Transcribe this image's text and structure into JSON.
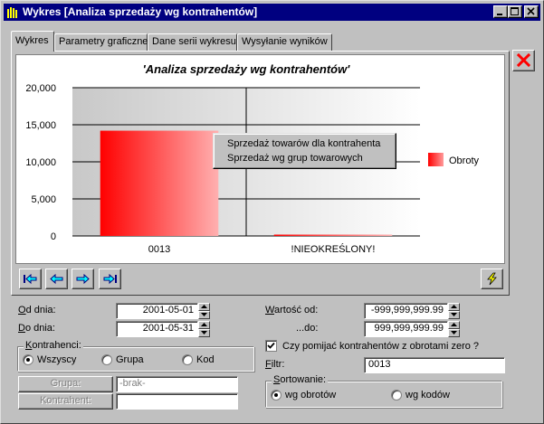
{
  "window": {
    "title": "Wykres [Analiza sprzedaży wg kontrahentów]",
    "app_icon": "bar-chart-icon",
    "controls": [
      "minimize-icon",
      "maximize-icon",
      "close-icon"
    ]
  },
  "tabs": [
    {
      "label": "Wykres",
      "active": true
    },
    {
      "label": "Parametry graficzne",
      "active": false
    },
    {
      "label": "Dane serii wykresu",
      "active": false
    },
    {
      "label": "Wysyłanie wyników",
      "active": false
    }
  ],
  "close_button_icon": "red-x-icon",
  "chart_data": {
    "type": "bar",
    "title": "'Analiza sprzedaży wg kontrahentów'",
    "categories": [
      "0013",
      "!NIEOKREŚLONY!"
    ],
    "series": [
      {
        "name": "Obroty",
        "values": [
          14200,
          150
        ],
        "color": "#ff0000"
      }
    ],
    "ylim": [
      0,
      20000
    ],
    "yticks": [
      "0",
      "5,000",
      "10,000",
      "15,000",
      "20,000"
    ],
    "grid": true,
    "legend": "right"
  },
  "context_menu": {
    "items": [
      "Sprzedaż towarów dla kontrahenta",
      "Sprzedaż wg grup towarowych"
    ]
  },
  "nav_buttons": [
    "first-icon",
    "prev-icon",
    "next-icon",
    "last-icon"
  ],
  "refresh_button_icon": "lightning-icon",
  "form": {
    "od_dnia_label": "Od dnia:",
    "od_dnia_value": "2001-05-01",
    "do_dnia_label": "Do dnia:",
    "do_dnia_value": "2001-05-31",
    "wartosc_od_label": "Wartość od:",
    "wartosc_od_value": "-999,999,999.99",
    "do_label": "...do:",
    "do_value": "999,999,999.99",
    "kontrahenci_title": "Kontrahenci:",
    "kontrahenci_options": [
      {
        "label": "Wszyscy",
        "selected": true
      },
      {
        "label": "Grupa",
        "selected": false
      },
      {
        "label": "Kod",
        "selected": false
      }
    ],
    "pomijac_label": "Czy pomijać kontrahentów z obrotami zero ?",
    "pomijac_checked": true,
    "filtr_label": "Filtr:",
    "filtr_value": "0013",
    "grupa_button": "Grupa:",
    "grupa_value": "-brak-",
    "kontrahent_button": "Kontrahent:",
    "kontrahent_value": "",
    "sortowanie_title": "Sortowanie:",
    "sortowanie_options": [
      {
        "label": "wg obrotów",
        "selected": true
      },
      {
        "label": "wg kodów",
        "selected": false
      }
    ]
  }
}
